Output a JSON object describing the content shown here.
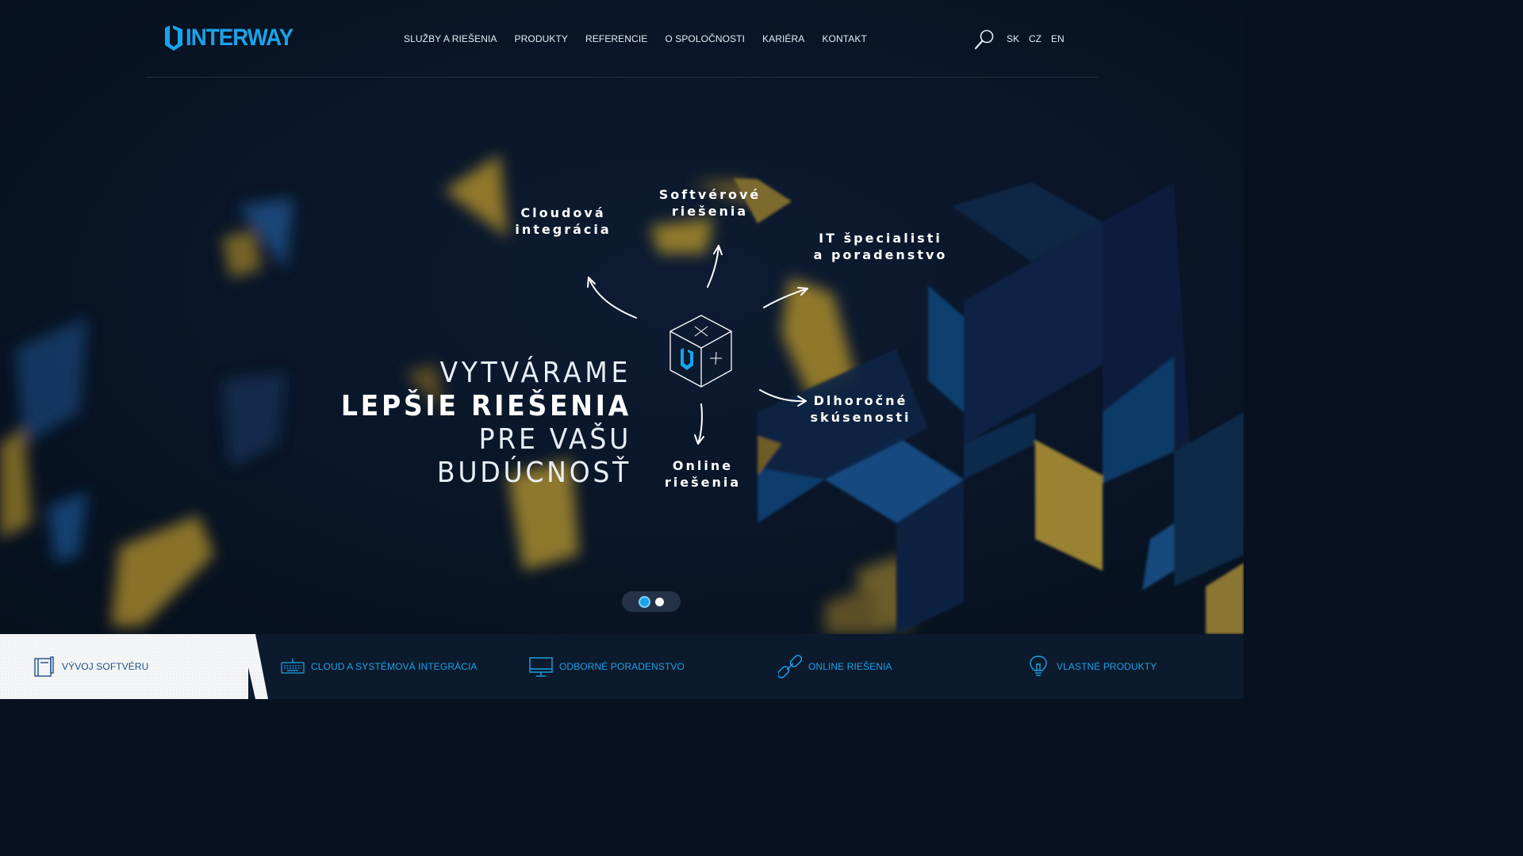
{
  "brand": {
    "name": "INTERWAY",
    "accent": "#1aa3e8",
    "gold": "#b8962f",
    "dark": "#07111f"
  },
  "nav": {
    "items": [
      "SLUŽBY A RIEŠENIA",
      "PRODUKTY",
      "REFERENCIE",
      "O SPOLOČNOSTI",
      "KARIÉRA",
      "KONTAKT"
    ],
    "search_icon": "search-icon",
    "languages": [
      "SK",
      "CZ",
      "EN"
    ]
  },
  "hero": {
    "line1": "VYTVÁRAME",
    "line2": "LEPŠIE RIEŠENIA",
    "line3": "PRE VAŠU BUDÚCNOSŤ"
  },
  "diagram": {
    "center_icon": "cube-logo-icon",
    "labels": [
      {
        "line1": "Cloudová",
        "line2": "integrácia"
      },
      {
        "line1": "Softvérové",
        "line2": "riešenia"
      },
      {
        "line1": "IT špecialisti",
        "line2": "a poradenstvo"
      },
      {
        "line1": "Dlhoročné",
        "line2": "skúsenosti"
      },
      {
        "line1": "Online",
        "line2": "riešenia"
      }
    ]
  },
  "slider": {
    "slides": 2,
    "active": 1
  },
  "bottom_tabs": [
    {
      "label": "VÝVOJ SOFTVÉRU",
      "icon": "notebook-icon",
      "active": true
    },
    {
      "label": "CLOUD A SYSTÉMOVÁ INTEGRÁCIA",
      "icon": "keyboard-icon",
      "active": false
    },
    {
      "label": "ODBORNÉ PORADENSTVO",
      "icon": "monitor-icon",
      "active": false
    },
    {
      "label": "ONLINE RIEŠENIA",
      "icon": "link-icon",
      "active": false
    },
    {
      "label": "VLASTNÉ PRODUKTY",
      "icon": "lightbulb-icon",
      "active": false
    }
  ]
}
